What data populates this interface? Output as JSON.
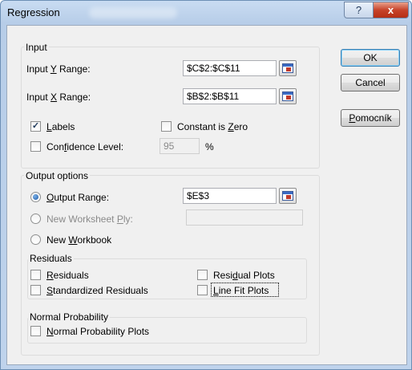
{
  "window": {
    "title": "Regression",
    "help_glyph": "?",
    "close_glyph": "x"
  },
  "buttons": {
    "ok": "OK",
    "cancel": "Cancel",
    "help_pre": "",
    "help_u": "P",
    "help_post": "omocník"
  },
  "input": {
    "group_title": "Input",
    "y_range": {
      "pre": "Input ",
      "u": "Y",
      "post": " Range:",
      "value": "$C$2:$C$11"
    },
    "x_range": {
      "pre": "Input ",
      "u": "X",
      "post": " Range:",
      "value": "$B$2:$B$11"
    },
    "labels": {
      "u": "L",
      "post": "abels",
      "checked": true
    },
    "constant_zero": {
      "pre": "Constant is ",
      "u": "Z",
      "post": "ero",
      "checked": false
    },
    "confidence": {
      "pre": "Con",
      "u": "f",
      "post": "idence Level:",
      "checked": false,
      "value": "95",
      "unit": "%"
    }
  },
  "output": {
    "group_title": "Output options",
    "output_range": {
      "u": "O",
      "post": "utput Range:",
      "value": "$E$3",
      "selected": true
    },
    "new_ply": {
      "pre": "New Worksheet ",
      "u": "P",
      "post": "ly:",
      "value": ""
    },
    "new_workbook": {
      "pre": "New ",
      "u": "W",
      "post": "orkbook"
    },
    "residuals": {
      "title": "Residuals",
      "residuals": {
        "u": "R",
        "post": "esiduals"
      },
      "standardized": {
        "u": "S",
        "post": "tandardized Residuals"
      },
      "residual_plots": {
        "pre": "Resi",
        "u": "d",
        "post": "ual Plots"
      },
      "line_fit": {
        "u": "L",
        "post": "ine Fit Plots"
      }
    },
    "normal": {
      "title": "Normal Probability",
      "plots": {
        "u": "N",
        "post": "ormal Probability Plots"
      }
    }
  }
}
